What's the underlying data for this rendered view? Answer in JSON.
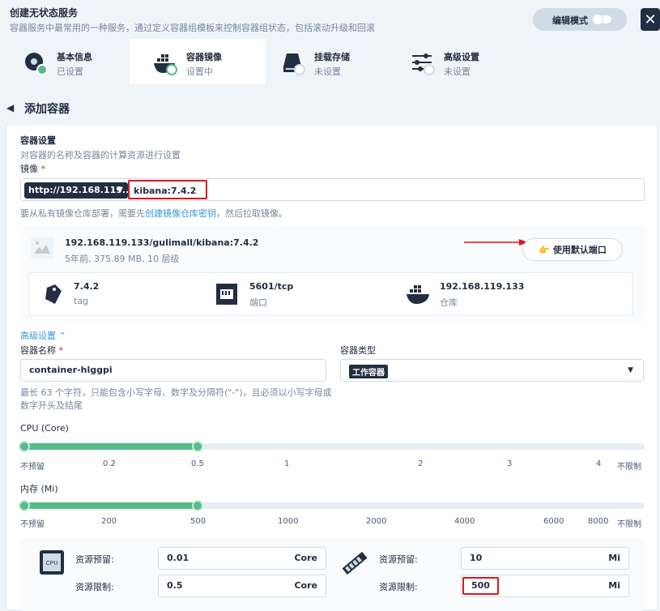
{
  "header": {
    "title": "创建无状态服务",
    "description": "容器服务中最常用的一种服务，通过定义容器组模板来控制容器组状态，包括滚动升级和回滚",
    "edit_mode_label": "编辑模式",
    "close_glyph": "✕"
  },
  "steps": [
    {
      "title": "基本信息",
      "status": "已设置"
    },
    {
      "title": "容器镜像",
      "status": "设置中"
    },
    {
      "title": "挂载存储",
      "status": "未设置"
    },
    {
      "title": "高级设置",
      "status": "未设置"
    }
  ],
  "back": {
    "arrow": "◀",
    "title": "添加容器"
  },
  "container_settings": {
    "section_title": "容器设置",
    "section_desc": "对容器的名称及容器的计算资源进行设置",
    "image_label": "镜像",
    "required_mark": "*",
    "registry": "http://192.168.119....",
    "registry_chevron": "▼",
    "image_value": "kibana:7.4.2",
    "hint_prefix": "要从私有镜像仓库部署，需要先",
    "hint_link": "创建镜像仓库密钥",
    "hint_suffix": "，然后拉取镜像。"
  },
  "image_card": {
    "full_name": "192.168.119.133/gulimall/kibana:7.4.2",
    "meta": "5年前, 375.89 MB, 10 层级",
    "use_default_port": "使用默认端口",
    "port_btn_icon": "👉",
    "tag_value": "7.4.2",
    "tag_label": "tag",
    "port_value": "5601/tcp",
    "port_label": "端口",
    "repo_value": "192.168.119.133",
    "repo_label": "仓库"
  },
  "advanced": {
    "toggle_label": "高级设置",
    "toggle_chevron": "⌃",
    "container_name_label": "容器名称",
    "required_mark": "*",
    "container_name_value": "container-hlggpi",
    "container_name_hint": "最长 63 个字符，只能包含小写字母、数字及分隔符(\"-\")，且必须以小写字母或数字开头及结尾",
    "container_type_label": "容器类型",
    "container_type_value": "工作容器",
    "container_type_caret": "▼"
  },
  "cpu": {
    "label": "CPU (Core)",
    "ticks": [
      "不预留",
      "0.2",
      "0.5",
      "1",
      "2",
      "3",
      "4",
      "不限制"
    ],
    "request": "0.01",
    "limit": "0.5"
  },
  "memory": {
    "label": "内存 (Mi)",
    "ticks": [
      "不预留",
      "200",
      "500",
      "1000",
      "2000",
      "4000",
      "6000",
      "8000",
      "不限制"
    ],
    "request": "10",
    "limit": "500"
  },
  "resources": {
    "cpu_icon_text": "CPU",
    "reserve_label": "资源预留:",
    "limit_label": "资源限制:",
    "cpu_unit": "Core",
    "mem_unit": "Mi"
  },
  "colors": {
    "accent_green": "#55bc8a",
    "dark": "#242e42",
    "highlight_red": "#e0161b"
  }
}
